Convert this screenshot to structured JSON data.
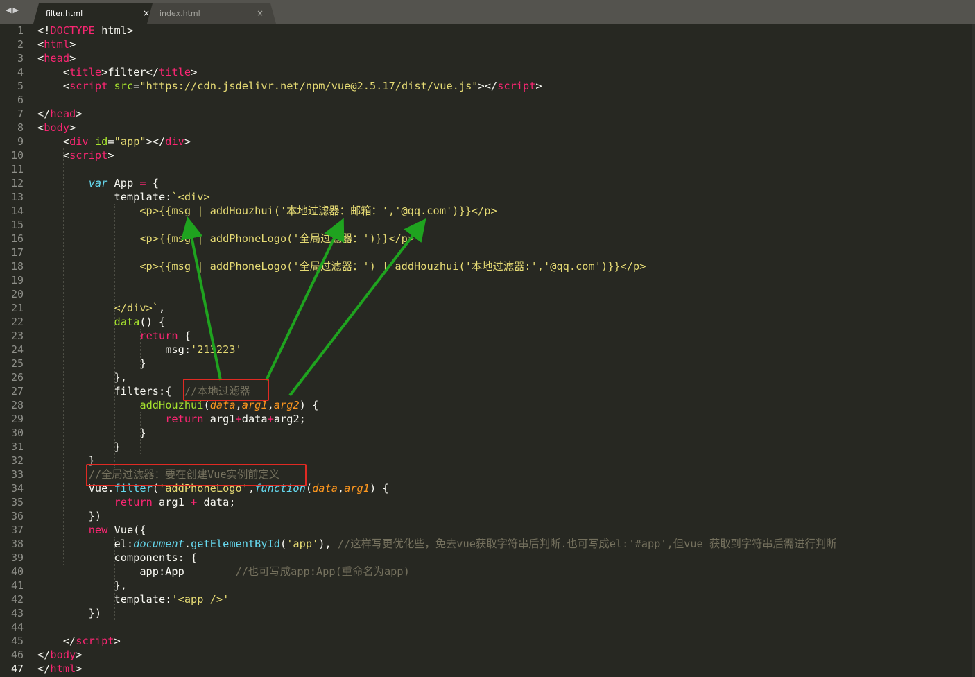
{
  "tabs": [
    {
      "label": "filter.html",
      "close": "×",
      "active": true
    },
    {
      "label": "index.html",
      "close": "×",
      "active": false
    }
  ],
  "nav": {
    "back": "◀",
    "forward": "▶"
  },
  "current_line": 47,
  "colors": {
    "background": "#272822",
    "tag": "#f92672",
    "attr": "#a6e22e",
    "string": "#e6db74",
    "keyword": "#66d9ef",
    "comment": "#75715e",
    "param": "#fd971f",
    "annotation_arrow": "#1fa31f",
    "annotation_box": "#e02a23"
  },
  "lines": [
    [
      [
        "d",
        "<!"
      ],
      [
        "t",
        "DOCTYPE"
      ],
      [
        "d",
        " html>"
      ]
    ],
    [
      [
        "d",
        "<"
      ],
      [
        "t",
        "html"
      ],
      [
        "d",
        ">"
      ]
    ],
    [
      [
        "d",
        "<"
      ],
      [
        "t",
        "head"
      ],
      [
        "d",
        ">"
      ]
    ],
    [
      [
        "d",
        "    <"
      ],
      [
        "t",
        "title"
      ],
      [
        "d",
        ">filter</"
      ],
      [
        "t",
        "title"
      ],
      [
        "d",
        ">"
      ]
    ],
    [
      [
        "d",
        "    <"
      ],
      [
        "t",
        "script"
      ],
      [
        "d",
        " "
      ],
      [
        "a",
        "src"
      ],
      [
        "d",
        "="
      ],
      [
        "s",
        "\"https://cdn.jsdelivr.net/npm/vue@2.5.17/dist/vue.js\""
      ],
      [
        "d",
        "></"
      ],
      [
        "t",
        "script"
      ],
      [
        "d",
        ">"
      ]
    ],
    [],
    [
      [
        "d",
        "</"
      ],
      [
        "t",
        "head"
      ],
      [
        "d",
        ">"
      ]
    ],
    [
      [
        "d",
        "<"
      ],
      [
        "t",
        "body"
      ],
      [
        "d",
        ">"
      ]
    ],
    [
      [
        "d",
        "    <"
      ],
      [
        "t",
        "div"
      ],
      [
        "d",
        " "
      ],
      [
        "a",
        "id"
      ],
      [
        "d",
        "="
      ],
      [
        "s",
        "\"app\""
      ],
      [
        "d",
        "></"
      ],
      [
        "t",
        "div"
      ],
      [
        "d",
        ">"
      ]
    ],
    [
      [
        "d",
        "    <"
      ],
      [
        "t",
        "script"
      ],
      [
        "d",
        ">"
      ]
    ],
    [],
    [
      [
        "d",
        "        "
      ],
      [
        "k",
        "var"
      ],
      [
        "d",
        " App "
      ],
      [
        "o",
        "="
      ],
      [
        "d",
        " {"
      ]
    ],
    [
      [
        "d",
        "            template:"
      ],
      [
        "s",
        "`<div>"
      ]
    ],
    [
      [
        "s",
        "                <p>{{msg | addHouzhui('本地过滤器：邮箱：','@qq.com')}}</p>"
      ]
    ],
    [],
    [
      [
        "s",
        "                <p>{{msg | addPhoneLogo('全局过滤器：')}}</p>"
      ]
    ],
    [],
    [
      [
        "s",
        "                <p>{{msg | addPhoneLogo('全局过滤器：') | addHouzhui('本地过滤器:','@qq.com')}}</p>"
      ]
    ],
    [],
    [],
    [
      [
        "s",
        "            </div>`"
      ],
      [
        "d",
        ","
      ]
    ],
    [
      [
        "d",
        "            "
      ],
      [
        "f",
        "data"
      ],
      [
        "d",
        "() {"
      ]
    ],
    [
      [
        "d",
        "                "
      ],
      [
        "o",
        "return"
      ],
      [
        "d",
        " {"
      ]
    ],
    [
      [
        "d",
        "                    msg:"
      ],
      [
        "s",
        "'213223'"
      ]
    ],
    [
      [
        "d",
        "                }"
      ]
    ],
    [
      [
        "d",
        "            },"
      ]
    ],
    [
      [
        "d",
        "            filters:{  "
      ],
      [
        "c",
        "//本地过滤器"
      ]
    ],
    [
      [
        "d",
        "                "
      ],
      [
        "f",
        "addHouzhui"
      ],
      [
        "d",
        "("
      ],
      [
        "p",
        "data"
      ],
      [
        "d",
        ","
      ],
      [
        "p",
        "arg1"
      ],
      [
        "d",
        ","
      ],
      [
        "p",
        "arg2"
      ],
      [
        "d",
        ") {"
      ]
    ],
    [
      [
        "d",
        "                    "
      ],
      [
        "o",
        "return"
      ],
      [
        "d",
        " arg1"
      ],
      [
        "o",
        "+"
      ],
      [
        "d",
        "data"
      ],
      [
        "o",
        "+"
      ],
      [
        "d",
        "arg2;"
      ]
    ],
    [
      [
        "d",
        "                }"
      ]
    ],
    [
      [
        "d",
        "            }"
      ]
    ],
    [
      [
        "d",
        "        }"
      ]
    ],
    [
      [
        "d",
        "        "
      ],
      [
        "c",
        "//全局过滤器：要在创建Vue实例前定义"
      ]
    ],
    [
      [
        "d",
        "        Vue."
      ],
      [
        "b",
        "filter"
      ],
      [
        "d",
        "("
      ],
      [
        "s",
        "'addPhoneLogo'"
      ],
      [
        "d",
        ","
      ],
      [
        "k",
        "function"
      ],
      [
        "d",
        "("
      ],
      [
        "p",
        "data"
      ],
      [
        "d",
        ","
      ],
      [
        "p",
        "arg1"
      ],
      [
        "d",
        ") {"
      ]
    ],
    [
      [
        "d",
        "            "
      ],
      [
        "o",
        "return"
      ],
      [
        "d",
        " arg1 "
      ],
      [
        "o",
        "+"
      ],
      [
        "d",
        " data;"
      ]
    ],
    [
      [
        "d",
        "        })"
      ]
    ],
    [
      [
        "d",
        "        "
      ],
      [
        "o",
        "new"
      ],
      [
        "d",
        " Vue({"
      ]
    ],
    [
      [
        "d",
        "            el:"
      ],
      [
        "k",
        "document"
      ],
      [
        "d",
        "."
      ],
      [
        "b",
        "getElementById"
      ],
      [
        "d",
        "("
      ],
      [
        "s",
        "'app'"
      ],
      [
        "d",
        "), "
      ],
      [
        "c",
        "//这样写更优化些，免去vue获取字符串后判断.也可写成el:'#app',但vue 获取到字符串后需进行判断"
      ]
    ],
    [
      [
        "d",
        "            components: {"
      ]
    ],
    [
      [
        "d",
        "                app:App        "
      ],
      [
        "c",
        "//也可写成app:App(重命名为app)"
      ]
    ],
    [
      [
        "d",
        "            },"
      ]
    ],
    [
      [
        "d",
        "            template:"
      ],
      [
        "s",
        "'<app />'"
      ]
    ],
    [
      [
        "d",
        "        })"
      ]
    ],
    [],
    [
      [
        "d",
        "    </"
      ],
      [
        "t",
        "script"
      ],
      [
        "d",
        ">"
      ]
    ],
    [
      [
        "d",
        "</"
      ],
      [
        "t",
        "body"
      ],
      [
        "d",
        ">"
      ]
    ],
    [
      [
        "d",
        "</"
      ],
      [
        "t",
        "html"
      ],
      [
        "d",
        ">"
      ]
    ]
  ]
}
